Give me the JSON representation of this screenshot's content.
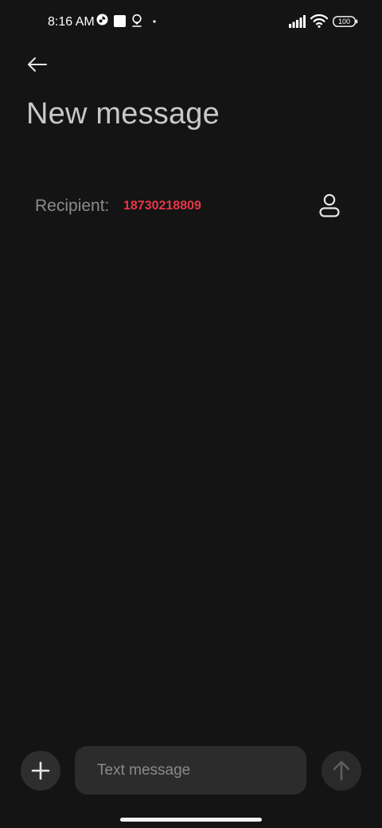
{
  "status_bar": {
    "time": "8:16 AM",
    "battery": "100",
    "icons": [
      "photos-app-icon",
      "square-notification-icon",
      "location-pin-icon",
      "dot-icon",
      "signal-icon",
      "wifi-icon",
      "battery-icon"
    ]
  },
  "header": {
    "back_icon": "arrow-left-icon",
    "title": "New message"
  },
  "recipient": {
    "label": "Recipient:",
    "value": "18730218809",
    "contact_icon": "person-icon",
    "value_color": "#e8364a"
  },
  "composer": {
    "attach_icon": "plus-icon",
    "placeholder": "Text message",
    "value": "",
    "send_icon": "arrow-up-icon"
  },
  "colors": {
    "background": "#141414",
    "accent": "#e8364a"
  }
}
